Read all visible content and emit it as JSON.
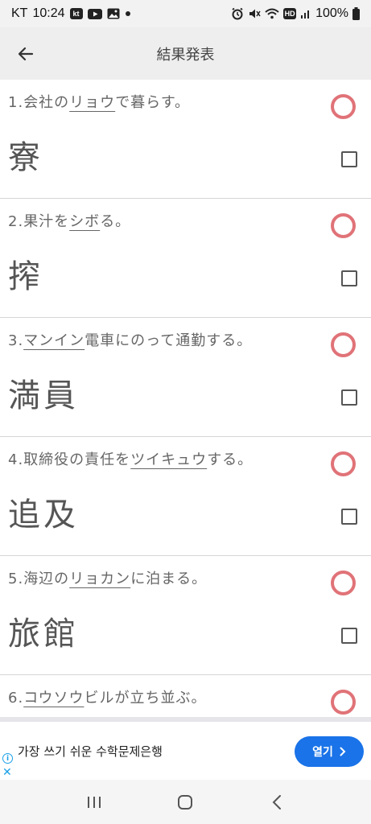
{
  "status_bar": {
    "carrier": "KT",
    "time": "10:24",
    "left_icons": [
      "kt-icon",
      "youtube-icon",
      "gallery-icon",
      "dot-icon"
    ],
    "right_icons": [
      "alarm-icon",
      "mute-icon",
      "wifi-icon",
      "hd-icon",
      "signal-icon",
      "battery-icon"
    ],
    "battery": "100%"
  },
  "app_bar": {
    "title": "結果発表",
    "back_icon": "back-arrow-icon"
  },
  "questions": [
    {
      "number": "1.",
      "before": "会社の",
      "underlined": "リョウ",
      "after": "で暮らす。",
      "answer": "寮",
      "result": "correct"
    },
    {
      "number": "2.",
      "before": "果汁を",
      "underlined": "シボ",
      "after": "る。",
      "answer": "搾",
      "result": "correct"
    },
    {
      "number": "3.",
      "before": "",
      "underlined": "マンイン",
      "after": "電車にのって通勤する。",
      "answer": "満員",
      "result": "correct"
    },
    {
      "number": "4.",
      "before": "取締役の責任を",
      "underlined": "ツイキュウ",
      "after": "する。",
      "answer": "追及",
      "result": "correct"
    },
    {
      "number": "5.",
      "before": "海辺の",
      "underlined": "リョカン",
      "after": "に泊まる。",
      "answer": "旅館",
      "result": "correct"
    },
    {
      "number": "6.",
      "before": "",
      "underlined": "コウソウ",
      "after": "ビルが立ち並ぶ。",
      "answer": "",
      "result": "correct"
    }
  ],
  "ad": {
    "text": "가장 쓰기 쉬운 수학문제은행",
    "button_label": "열기",
    "info_icon": "info-icon",
    "close_icon": "close-icon"
  },
  "nav_bar": {
    "icons": [
      "recent-apps-icon",
      "home-icon",
      "back-icon"
    ]
  },
  "colors": {
    "correct_mark": "#e07378",
    "ad_button": "#1a73e8"
  }
}
